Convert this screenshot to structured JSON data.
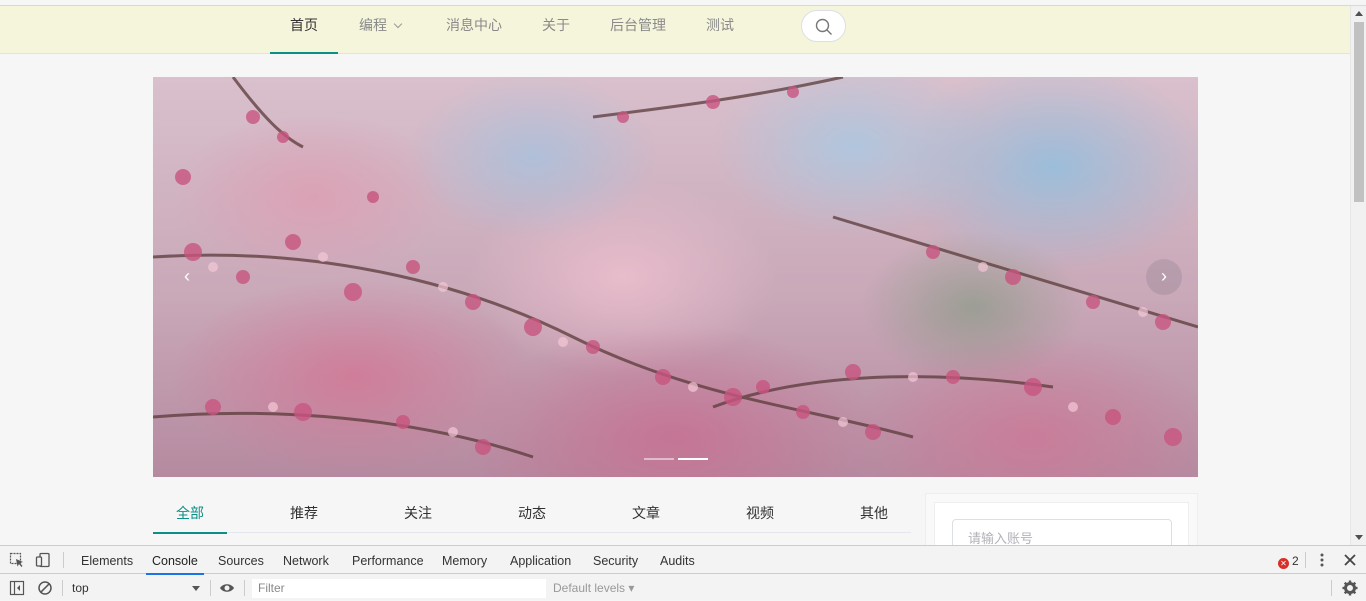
{
  "nav": {
    "items": [
      {
        "label": "首页",
        "active": true
      },
      {
        "label": "编程",
        "has_dropdown": true
      },
      {
        "label": "消息中心"
      },
      {
        "label": "关于"
      },
      {
        "label": "后台管理"
      },
      {
        "label": "测试"
      }
    ],
    "search_icon": "search-icon",
    "background": "#f5f5dc",
    "accent": "#0b8f86"
  },
  "carousel": {
    "prev_glyph": "‹",
    "next_glyph": "›",
    "slide_count": 2,
    "active_index": 1
  },
  "tabs": {
    "items": [
      "全部",
      "推荐",
      "关注",
      "动态",
      "文章",
      "视频",
      "其他"
    ],
    "active": "全部"
  },
  "sidebar": {
    "account_placeholder": "请输入账号"
  },
  "devtools": {
    "tabs": [
      "Elements",
      "Console",
      "Sources",
      "Network",
      "Performance",
      "Memory",
      "Application",
      "Security",
      "Audits"
    ],
    "active_tab": "Console",
    "error_count": "2",
    "context": "top",
    "filter_placeholder": "Filter",
    "levels": "Default levels ▾",
    "accent": "#1a73e8"
  }
}
